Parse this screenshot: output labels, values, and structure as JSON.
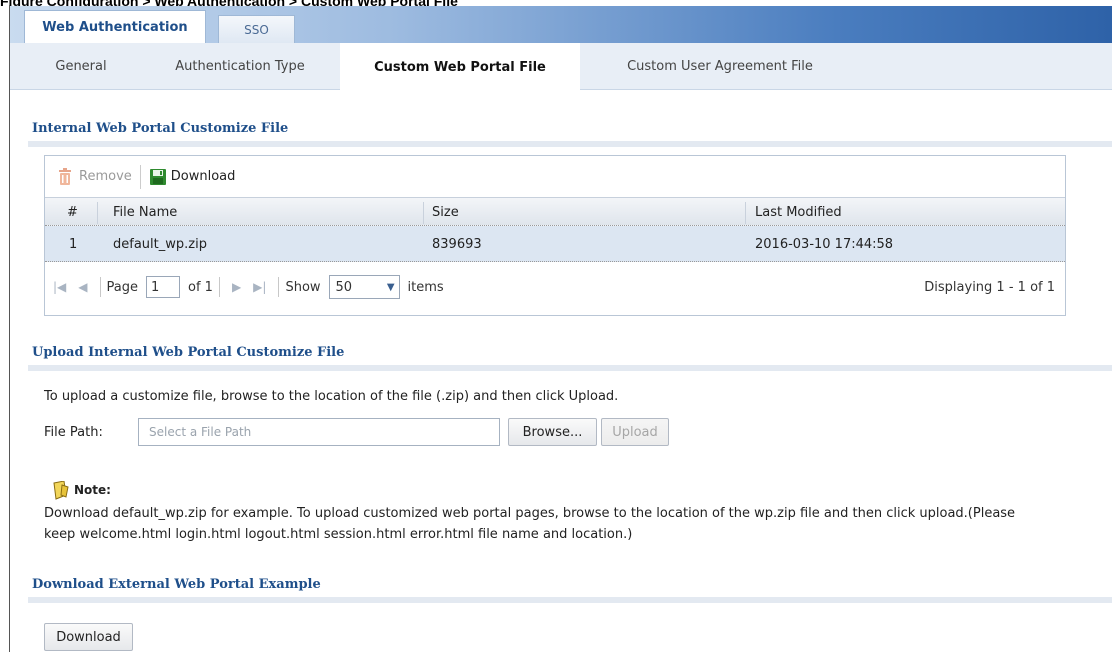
{
  "figure_label": "Figure   Configuration > Web Authentication > Custom Web Portal File",
  "top_tabs": [
    {
      "label": "Web Authentication",
      "active": true
    },
    {
      "label": "SSO",
      "active": false
    }
  ],
  "sub_tabs": [
    {
      "label": "General",
      "active": false
    },
    {
      "label": "Authentication Type",
      "active": false
    },
    {
      "label": "Custom Web Portal File",
      "active": true
    },
    {
      "label": "Custom User Agreement File",
      "active": false
    }
  ],
  "sections": {
    "internal": "Internal Web Portal Customize File",
    "upload": "Upload Internal Web Portal Customize File",
    "external": "Download External Web Portal Example"
  },
  "toolbar": {
    "remove_label": "Remove",
    "download_label": "Download",
    "remove_icon": "trash-icon",
    "download_icon": "save-disk-icon"
  },
  "table": {
    "columns": [
      "#",
      "File Name",
      "Size",
      "Last Modified"
    ],
    "rows": [
      {
        "index": "1",
        "file_name": "default_wp.zip",
        "size": "839693",
        "last_modified": "2016-03-10 17:44:58"
      }
    ]
  },
  "pager": {
    "page_label": "Page",
    "page_value": "1",
    "of_label": "of 1",
    "show_label": "Show",
    "show_value": "50",
    "items_label": "items",
    "displaying": "Displaying 1 - 1 of 1"
  },
  "upload": {
    "instructions": "To upload a customize file, browse to the location of the file (.zip) and then click Upload.",
    "file_path_label": "File Path:",
    "file_path_placeholder": "Select a File Path",
    "browse_label": "Browse...",
    "upload_label": "Upload"
  },
  "note": {
    "title": "Note:",
    "line1": "Download default_wp.zip for example. To upload customized web portal pages, browse to the location of the wp.zip file and then click upload.(Please",
    "line2": "keep welcome.html login.html logout.html session.html error.html file name and location.)"
  },
  "external": {
    "download_label": "Download"
  },
  "colors": {
    "accent": "#1f4f8a",
    "selected_row": "#dce6f2",
    "tab_bar": "#2e62a8"
  }
}
